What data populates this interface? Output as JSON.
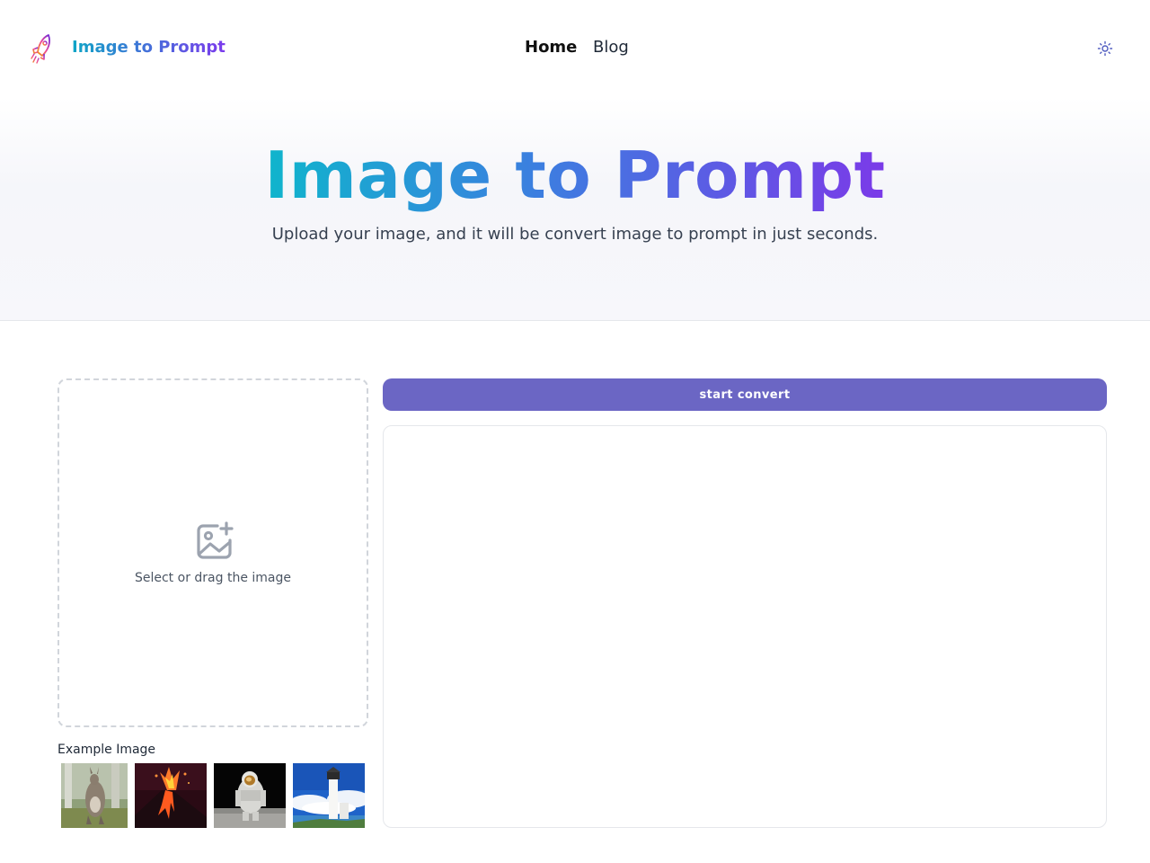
{
  "header": {
    "brand": "Image to Prompt",
    "nav": {
      "home": "Home",
      "blog": "Blog"
    },
    "logo_icon": "rocket-icon",
    "theme_icon": "sun-icon"
  },
  "hero": {
    "title": "Image to Prompt",
    "subtitle": "Upload your image, and it will be convert image to prompt in just seconds."
  },
  "upload": {
    "icon": "image-add-icon",
    "hint": "Select or drag the image"
  },
  "examples": {
    "label": "Example Image",
    "items": [
      "kangaroo",
      "volcano",
      "astronaut",
      "lighthouse"
    ]
  },
  "convert": {
    "label": "start convert"
  },
  "colors": {
    "accent": "#6b66c4",
    "gradient_start": "#0fb5cc",
    "gradient_end": "#7b3ae8"
  }
}
